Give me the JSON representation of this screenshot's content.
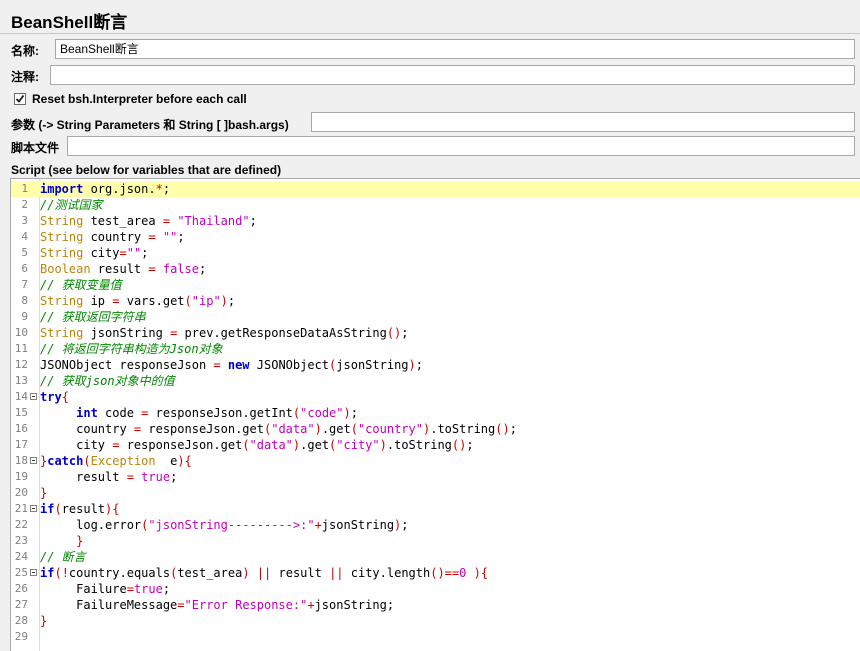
{
  "page": {
    "title": "BeanShell断言"
  },
  "form": {
    "name_label": "名称:",
    "name_value": "BeanShell断言",
    "comment_label": "注释:",
    "comment_value": "",
    "reset_label": "Reset bsh.Interpreter before each call",
    "reset_checked": true,
    "params_label": "参数 (-> String Parameters 和 String [ ]bash.args)",
    "params_value": "",
    "script_file_label": "脚本文件",
    "script_file_value": "",
    "script_label": "Script (see below for variables that are defined)"
  },
  "editor": {
    "current_line": 1,
    "lines": [
      {
        "n": "1"
      },
      {
        "n": "2"
      },
      {
        "n": "3"
      },
      {
        "n": "4"
      },
      {
        "n": "5"
      },
      {
        "n": "6"
      },
      {
        "n": "7"
      },
      {
        "n": "8"
      },
      {
        "n": "9"
      },
      {
        "n": "10"
      },
      {
        "n": "11"
      },
      {
        "n": "12"
      },
      {
        "n": "13"
      },
      {
        "n": "14"
      },
      {
        "n": "15"
      },
      {
        "n": "16"
      },
      {
        "n": "17"
      },
      {
        "n": "18"
      },
      {
        "n": "19"
      },
      {
        "n": "20"
      },
      {
        "n": "21"
      },
      {
        "n": "22"
      },
      {
        "n": "23"
      },
      {
        "n": "24"
      },
      {
        "n": "25"
      },
      {
        "n": "26"
      },
      {
        "n": "27"
      },
      {
        "n": "28"
      },
      {
        "n": "29"
      }
    ],
    "code": [
      [
        [
          "k",
          "import"
        ],
        [
          "n",
          " org.json."
        ],
        [
          "p",
          "*"
        ],
        [
          "n",
          ";"
        ]
      ],
      [
        [
          "c",
          "//测试国家"
        ]
      ],
      [
        [
          "t",
          "String"
        ],
        [
          "n",
          " test_area "
        ],
        [
          "p",
          "="
        ],
        [
          "n",
          " "
        ],
        [
          "s",
          "\"Thailand\""
        ],
        [
          "n",
          ";"
        ]
      ],
      [
        [
          "t",
          "String"
        ],
        [
          "n",
          " country "
        ],
        [
          "p",
          "="
        ],
        [
          "n",
          " "
        ],
        [
          "s",
          "\"\""
        ],
        [
          "n",
          ";"
        ]
      ],
      [
        [
          "t",
          "String"
        ],
        [
          "n",
          " city"
        ],
        [
          "p",
          "="
        ],
        [
          "s",
          "\"\""
        ],
        [
          "n",
          ";"
        ]
      ],
      [
        [
          "t",
          "Boolean"
        ],
        [
          "n",
          " result "
        ],
        [
          "p",
          "="
        ],
        [
          "n",
          " "
        ],
        [
          "s",
          "false"
        ],
        [
          "n",
          ";"
        ]
      ],
      [
        [
          "c",
          "// 获取变量值"
        ]
      ],
      [
        [
          "t",
          "String"
        ],
        [
          "n",
          " ip "
        ],
        [
          "p",
          "="
        ],
        [
          "n",
          " vars.get"
        ],
        [
          "p",
          "("
        ],
        [
          "s",
          "\"ip\""
        ],
        [
          "p",
          ")"
        ],
        [
          "n",
          ";"
        ]
      ],
      [
        [
          "c",
          "// 获取返回字符串"
        ]
      ],
      [
        [
          "t",
          "String"
        ],
        [
          "n",
          " jsonString "
        ],
        [
          "p",
          "="
        ],
        [
          "n",
          " prev.getResponseDataAsString"
        ],
        [
          "p",
          "()"
        ],
        [
          "n",
          ";"
        ]
      ],
      [
        [
          "c",
          "// 将返回字符串构造为Json对象"
        ]
      ],
      [
        [
          "n",
          "JSONObject responseJson "
        ],
        [
          "p",
          "="
        ],
        [
          "n",
          " "
        ],
        [
          "k",
          "new"
        ],
        [
          "n",
          " JSONObject"
        ],
        [
          "p",
          "("
        ],
        [
          "n",
          "jsonString"
        ],
        [
          "p",
          ")"
        ],
        [
          "n",
          ";"
        ]
      ],
      [
        [
          "c",
          "// 获取json对象中的值"
        ]
      ],
      [
        [
          "k",
          "try"
        ],
        [
          "p",
          "{"
        ]
      ],
      [
        [
          "n",
          "     "
        ],
        [
          "k",
          "int"
        ],
        [
          "n",
          " code "
        ],
        [
          "p",
          "="
        ],
        [
          "n",
          " responseJson.getInt"
        ],
        [
          "p",
          "("
        ],
        [
          "s",
          "\"code\""
        ],
        [
          "p",
          ")"
        ],
        [
          "n",
          ";"
        ]
      ],
      [
        [
          "n",
          "     country "
        ],
        [
          "p",
          "="
        ],
        [
          "n",
          " responseJson.get"
        ],
        [
          "p",
          "("
        ],
        [
          "s",
          "\"data\""
        ],
        [
          "p",
          ")"
        ],
        [
          "n",
          ".get"
        ],
        [
          "p",
          "("
        ],
        [
          "s",
          "\"country\""
        ],
        [
          "p",
          ")"
        ],
        [
          "n",
          ".toString"
        ],
        [
          "p",
          "()"
        ],
        [
          "n",
          ";"
        ]
      ],
      [
        [
          "n",
          "     city "
        ],
        [
          "p",
          "="
        ],
        [
          "n",
          " responseJson.get"
        ],
        [
          "p",
          "("
        ],
        [
          "s",
          "\"data\""
        ],
        [
          "p",
          ")"
        ],
        [
          "n",
          ".get"
        ],
        [
          "p",
          "("
        ],
        [
          "s",
          "\"city\""
        ],
        [
          "p",
          ")"
        ],
        [
          "n",
          ".toString"
        ],
        [
          "p",
          "()"
        ],
        [
          "n",
          ";"
        ]
      ],
      [
        [
          "p",
          "}"
        ],
        [
          "k",
          "catch"
        ],
        [
          "p",
          "("
        ],
        [
          "t",
          "Exception"
        ],
        [
          "n",
          "  e"
        ],
        [
          "p",
          ")"
        ],
        [
          "p",
          "{"
        ]
      ],
      [
        [
          "n",
          "     result "
        ],
        [
          "p",
          "="
        ],
        [
          "n",
          " "
        ],
        [
          "s",
          "true"
        ],
        [
          "n",
          ";"
        ]
      ],
      [
        [
          "p",
          "}"
        ]
      ],
      [
        [
          "k",
          "if"
        ],
        [
          "p",
          "("
        ],
        [
          "n",
          "result"
        ],
        [
          "p",
          ")"
        ],
        [
          "p",
          "{"
        ]
      ],
      [
        [
          "n",
          "     log.error"
        ],
        [
          "p",
          "("
        ],
        [
          "s",
          "\"jsonString--------->:\""
        ],
        [
          "p",
          "+"
        ],
        [
          "n",
          "jsonString"
        ],
        [
          "p",
          ")"
        ],
        [
          "n",
          ";"
        ]
      ],
      [
        [
          "n",
          "     "
        ],
        [
          "p",
          "}"
        ]
      ],
      [
        [
          "c",
          "// 断言"
        ]
      ],
      [
        [
          "k",
          "if"
        ],
        [
          "p",
          "("
        ],
        [
          "p",
          "!"
        ],
        [
          "n",
          "country.equals"
        ],
        [
          "p",
          "("
        ],
        [
          "n",
          "test_area"
        ],
        [
          "p",
          ")"
        ],
        [
          "n",
          " "
        ],
        [
          "p",
          "||"
        ],
        [
          "n",
          " result "
        ],
        [
          "p",
          "||"
        ],
        [
          "n",
          " city.length"
        ],
        [
          "p",
          "()"
        ],
        [
          "p",
          "=="
        ],
        [
          "s",
          "0"
        ],
        [
          "n",
          " "
        ],
        [
          "p",
          ")"
        ],
        [
          "p",
          "{"
        ]
      ],
      [
        [
          "n",
          "     Failure"
        ],
        [
          "p",
          "="
        ],
        [
          "s",
          "true"
        ],
        [
          "n",
          ";"
        ]
      ],
      [
        [
          "n",
          "     FailureMessage"
        ],
        [
          "p",
          "="
        ],
        [
          "s",
          "\"Error Response:\""
        ],
        [
          "p",
          "+"
        ],
        [
          "n",
          "jsonString;"
        ]
      ],
      [
        [
          "p",
          "}"
        ]
      ],
      []
    ],
    "folds": [
      14,
      18,
      21,
      25
    ]
  }
}
